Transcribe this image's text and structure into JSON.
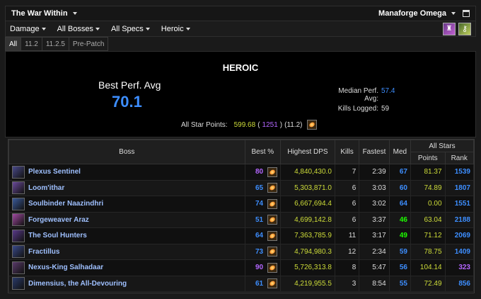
{
  "top": {
    "expansion": "The War Within",
    "zone": "Manaforge Omega"
  },
  "filters": [
    "Damage",
    "All Bosses",
    "All Specs",
    "Heroic"
  ],
  "tabs": [
    "All",
    "11.2",
    "11.2.5",
    "Pre-Patch"
  ],
  "summary": {
    "difficulty": "HEROIC",
    "best_label": "Best Perf. Avg",
    "best_value": "70.1",
    "median_label": "Median Perf. Avg:",
    "median_value": "57.4",
    "kills_label": "Kills Logged:",
    "kills_value": "59",
    "allstar_label": "All Star Points:",
    "allstar_value": "599.68",
    "allstar_rank": "1251",
    "allstar_patch": "(11.2)"
  },
  "table": {
    "headers": {
      "boss": "Boss",
      "best": "Best %",
      "dps": "Highest DPS",
      "kills": "Kills",
      "fastest": "Fastest",
      "med": "Med",
      "allstars": "All Stars",
      "points": "Points",
      "rank": "Rank"
    },
    "rows": [
      {
        "boss": "Plexus Sentinel",
        "best": "80",
        "best_color": "#b366ff",
        "dps": "4,840,430.0",
        "kills": "7",
        "fastest": "2:39",
        "med": "67",
        "med_color": "#3d8eff",
        "points": "81.37",
        "rank": "1539",
        "rank_color": "#3d8eff",
        "icon_color": "#4a4a8a"
      },
      {
        "boss": "Loom'ithar",
        "best": "65",
        "best_color": "#3d8eff",
        "dps": "5,303,871.0",
        "kills": "6",
        "fastest": "3:03",
        "med": "60",
        "med_color": "#3d8eff",
        "points": "74.89",
        "rank": "1807",
        "rank_color": "#3d8eff",
        "icon_color": "#6a4a9a"
      },
      {
        "boss": "Soulbinder Naazindhri",
        "best": "74",
        "best_color": "#3d8eff",
        "dps": "6,667,694.4",
        "kills": "6",
        "fastest": "3:02",
        "med": "64",
        "med_color": "#3d8eff",
        "points": "0.00",
        "rank": "1551",
        "rank_color": "#3d8eff",
        "icon_color": "#3a5a9a"
      },
      {
        "boss": "Forgeweaver Araz",
        "best": "51",
        "best_color": "#3d8eff",
        "dps": "4,699,142.8",
        "kills": "6",
        "fastest": "3:37",
        "med": "46",
        "med_color": "#1eff00",
        "points": "63.04",
        "rank": "2188",
        "rank_color": "#3d8eff",
        "icon_color": "#a04aa0"
      },
      {
        "boss": "The Soul Hunters",
        "best": "64",
        "best_color": "#3d8eff",
        "dps": "7,363,785.9",
        "kills": "11",
        "fastest": "3:17",
        "med": "49",
        "med_color": "#1eff00",
        "points": "71.12",
        "rank": "2069",
        "rank_color": "#3d8eff",
        "icon_color": "#5a3a8a"
      },
      {
        "boss": "Fractillus",
        "best": "73",
        "best_color": "#3d8eff",
        "dps": "4,794,980.3",
        "kills": "12",
        "fastest": "2:34",
        "med": "59",
        "med_color": "#3d8eff",
        "points": "78.75",
        "rank": "1409",
        "rank_color": "#3d8eff",
        "icon_color": "#3a4a8a"
      },
      {
        "boss": "Nexus-King Salhadaar",
        "best": "90",
        "best_color": "#b366ff",
        "dps": "5,726,313.8",
        "kills": "8",
        "fastest": "5:47",
        "med": "56",
        "med_color": "#3d8eff",
        "points": "104.14",
        "rank": "323",
        "rank_color": "#b366ff",
        "icon_color": "#5a3a6a"
      },
      {
        "boss": "Dimensius, the All-Devouring",
        "best": "61",
        "best_color": "#3d8eff",
        "dps": "4,219,955.5",
        "kills": "3",
        "fastest": "8:54",
        "med": "55",
        "med_color": "#3d8eff",
        "points": "72.49",
        "rank": "856",
        "rank_color": "#3d8eff",
        "icon_color": "#2a3a6a"
      }
    ]
  }
}
